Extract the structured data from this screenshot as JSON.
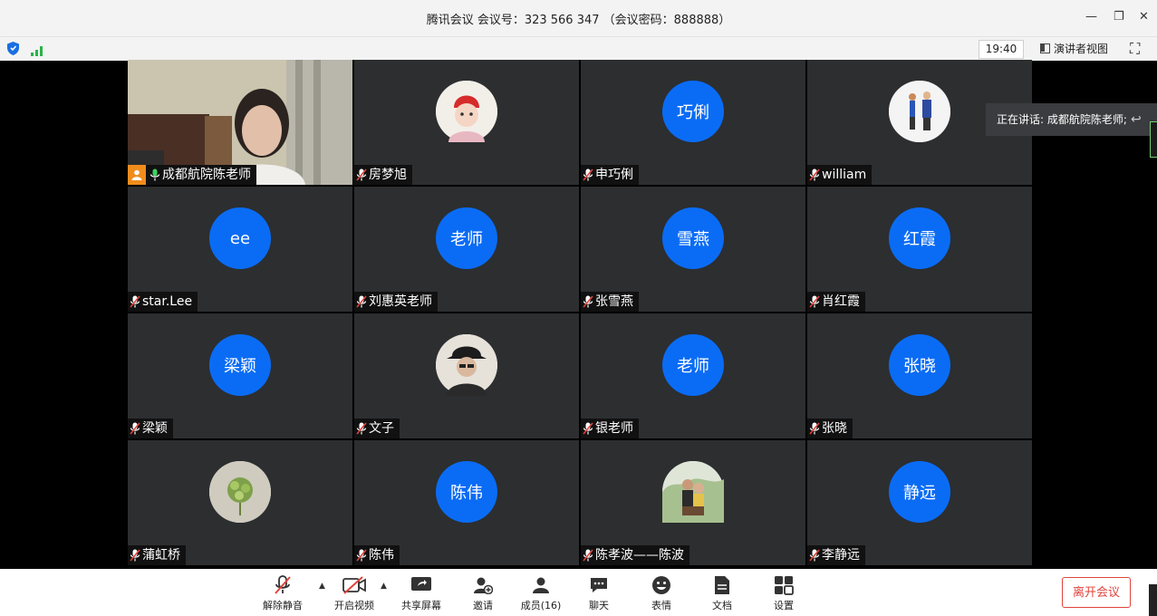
{
  "window": {
    "title": "腾讯会议 会议号：323 566 347 （会议密码：888888）",
    "minimize_glyph": "—",
    "restore_glyph": "❐",
    "close_glyph": "✕"
  },
  "toolbar": {
    "time": "19:40",
    "speaker_view_label": "演讲者视图",
    "fullscreen_glyph": "⛶"
  },
  "speaking": {
    "text": "正在讲话: 成都航院陈老师;"
  },
  "participants": [
    {
      "name": "成都航院陈老师",
      "avatar": "",
      "type": "video"
    },
    {
      "name": "房梦旭",
      "avatar": "",
      "type": "photo"
    },
    {
      "name": " 申巧俐",
      "avatar": "巧俐",
      "type": "text"
    },
    {
      "name": "william",
      "avatar": "",
      "type": "photo"
    },
    {
      "name": "star.Lee",
      "avatar": "ee",
      "type": "text"
    },
    {
      "name": "刘惠英老师",
      "avatar": "老师",
      "type": "text"
    },
    {
      "name": "张雪燕",
      "avatar": "雪燕",
      "type": "text"
    },
    {
      "name": "肖红霞",
      "avatar": "红霞",
      "type": "text"
    },
    {
      "name": "梁颖",
      "avatar": "梁颖",
      "type": "text"
    },
    {
      "name": "文子",
      "avatar": "",
      "type": "photo"
    },
    {
      "name": "银老师",
      "avatar": "老师",
      "type": "text"
    },
    {
      "name": "张晓",
      "avatar": "张晓",
      "type": "text"
    },
    {
      "name": "蒲虹桥",
      "avatar": "",
      "type": "photo"
    },
    {
      "name": "陈伟",
      "avatar": "陈伟",
      "type": "text"
    },
    {
      "name": "陈孝波——陈波",
      "avatar": "",
      "type": "photo"
    },
    {
      "name": "李静远",
      "avatar": "静远",
      "type": "text"
    }
  ],
  "bottom": {
    "unmute": "解除静音",
    "video": "开启视频",
    "share": "共享屏幕",
    "invite": "邀请",
    "members": "成员(16)",
    "chat": "聊天",
    "emoji": "表情",
    "docs": "文档",
    "settings": "设置",
    "leave": "离开会议"
  },
  "colors": {
    "avatar_blue": "#0a6cf5",
    "tile_bg": "#2c2e30",
    "leave_red": "#e0433b",
    "active_green": "#39c25a"
  }
}
